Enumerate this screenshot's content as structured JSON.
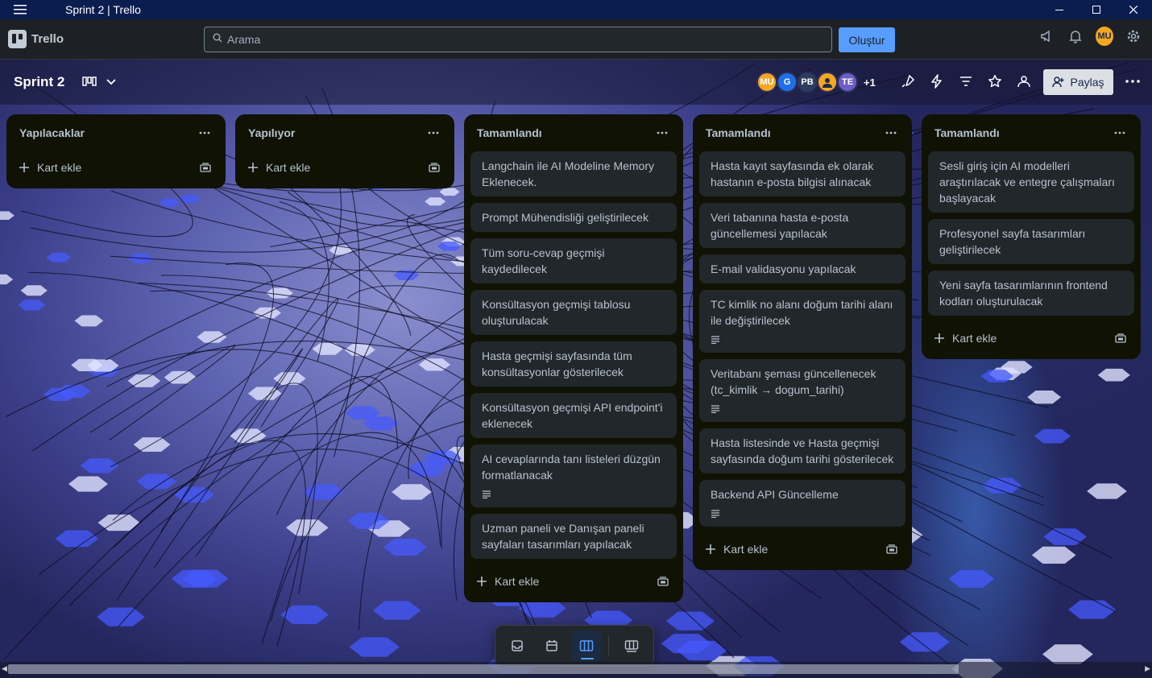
{
  "window": {
    "title": "Sprint 2 | Trello"
  },
  "nav": {
    "app_name": "Trello",
    "search_placeholder": "Arama",
    "create_label": "Oluştur",
    "user_initials": "MU"
  },
  "board": {
    "name": "Sprint 2",
    "members": [
      {
        "initials": "MU",
        "color": "#f5a623"
      },
      {
        "initials": "G",
        "color": "#1f6feb"
      },
      {
        "initials": "PB",
        "color": "#2c3e5d"
      },
      {
        "initials": "",
        "color": "#f5a623"
      },
      {
        "initials": "TE",
        "color": "#6e5dc6"
      }
    ],
    "more_members": "+1",
    "share_label": "Paylaş"
  },
  "lists": [
    {
      "title": "Yapılacaklar",
      "add_label": "Kart ekle",
      "cards": []
    },
    {
      "title": "Yapılıyor",
      "add_label": "Kart ekle",
      "cards": []
    },
    {
      "title": "Tamamlandı",
      "add_label": "Kart ekle",
      "cards": [
        {
          "text": "Langchain ile AI Modeline Memory Eklenecek."
        },
        {
          "text": "Prompt Mühendisliği geliştirilecek"
        },
        {
          "text": "Tüm soru-cevap geçmişi kaydedilecek"
        },
        {
          "text": "Konsültasyon geçmişi tablosu oluşturulacak"
        },
        {
          "text": "Hasta geçmişi sayfasında tüm konsültasyonlar gösterilecek"
        },
        {
          "text": "Konsültasyon geçmişi API endpoint'i eklenecek"
        },
        {
          "text": "AI cevaplarında tanı listeleri düzgün formatlanacak",
          "has_description": true
        },
        {
          "text": "Uzman paneli ve Danışan paneli sayfaları tasarımları yapılacak"
        }
      ]
    },
    {
      "title": "Tamamlandı",
      "add_label": "Kart ekle",
      "cards": [
        {
          "text": "Hasta kayıt sayfasında ek olarak hastanın e-posta bilgisi alınacak"
        },
        {
          "text": "Veri tabanına hasta e-posta güncellemesi yapılacak"
        },
        {
          "text": "E-mail validasyonu yapılacak"
        },
        {
          "text": "TC kimlik no alanı doğum tarihi alanı ile değiştirilecek",
          "has_description": true
        },
        {
          "text": "Veritabanı şeması güncellenecek (tc_kimlik → dogum_tarihi)",
          "has_description": true
        },
        {
          "text": "Hasta listesinde ve Hasta geçmişi sayfasında doğum tarihi gösterilecek"
        },
        {
          "text": "Backend API Güncelleme",
          "has_description": true
        }
      ]
    },
    {
      "title": "Tamamlandı",
      "add_label": "Kart ekle",
      "cards": [
        {
          "text": "Sesli giriş için AI modelleri araştırılacak ve entegre çalışmaları başlayacak"
        },
        {
          "text": "Profesyonel sayfa tasarımları geliştirilecek"
        },
        {
          "text": "Yeni sayfa tasarımlarının frontend kodları oluşturulacak"
        }
      ]
    }
  ],
  "view_switcher": {
    "items": [
      {
        "icon": "inbox-icon",
        "active": false
      },
      {
        "icon": "calendar-icon",
        "active": false
      },
      {
        "icon": "board-icon",
        "active": true
      },
      {
        "icon": "switch-boards-icon",
        "active": false
      }
    ]
  },
  "colors": {
    "accent": "#579dff",
    "list_bg": "#101204",
    "card_bg": "#22272b",
    "nav_bg": "#1d2125",
    "titlebar_bg": "#0b1d4f"
  }
}
